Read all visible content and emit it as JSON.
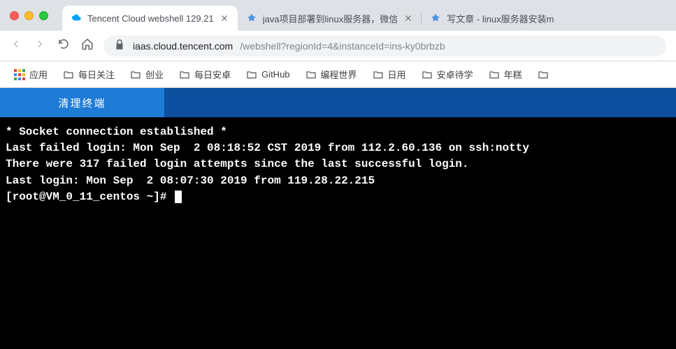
{
  "tabs": [
    {
      "title": "Tencent Cloud webshell 129.21",
      "favicon": "tencent-cloud"
    },
    {
      "title": "java项目部署到linux服务器，微信",
      "favicon": "csdn"
    },
    {
      "title": "写文章 - linux服务器安装m",
      "favicon": "csdn"
    }
  ],
  "address": {
    "host": "iaas.cloud.tencent.com",
    "path": "/webshell?regionId=4&instanceId=ins-ky0brbzb"
  },
  "bookmarks": {
    "apps_label": "应用",
    "items": [
      "每日关注",
      "创业",
      "每日安卓",
      "GitHub",
      "编程世界",
      "日用",
      "安卓待学",
      "年糕"
    ]
  },
  "page": {
    "clear_terminal": "清理终端"
  },
  "terminal": {
    "lines": [
      "* Socket connection established *",
      "Last failed login: Mon Sep  2 08:18:52 CST 2019 from 112.2.60.136 on ssh:notty",
      "There were 317 failed login attempts since the last successful login.",
      "Last login: Mon Sep  2 08:07:30 2019 from 119.28.22.215"
    ],
    "prompt": "[root@VM_0_11_centos ~]# "
  }
}
